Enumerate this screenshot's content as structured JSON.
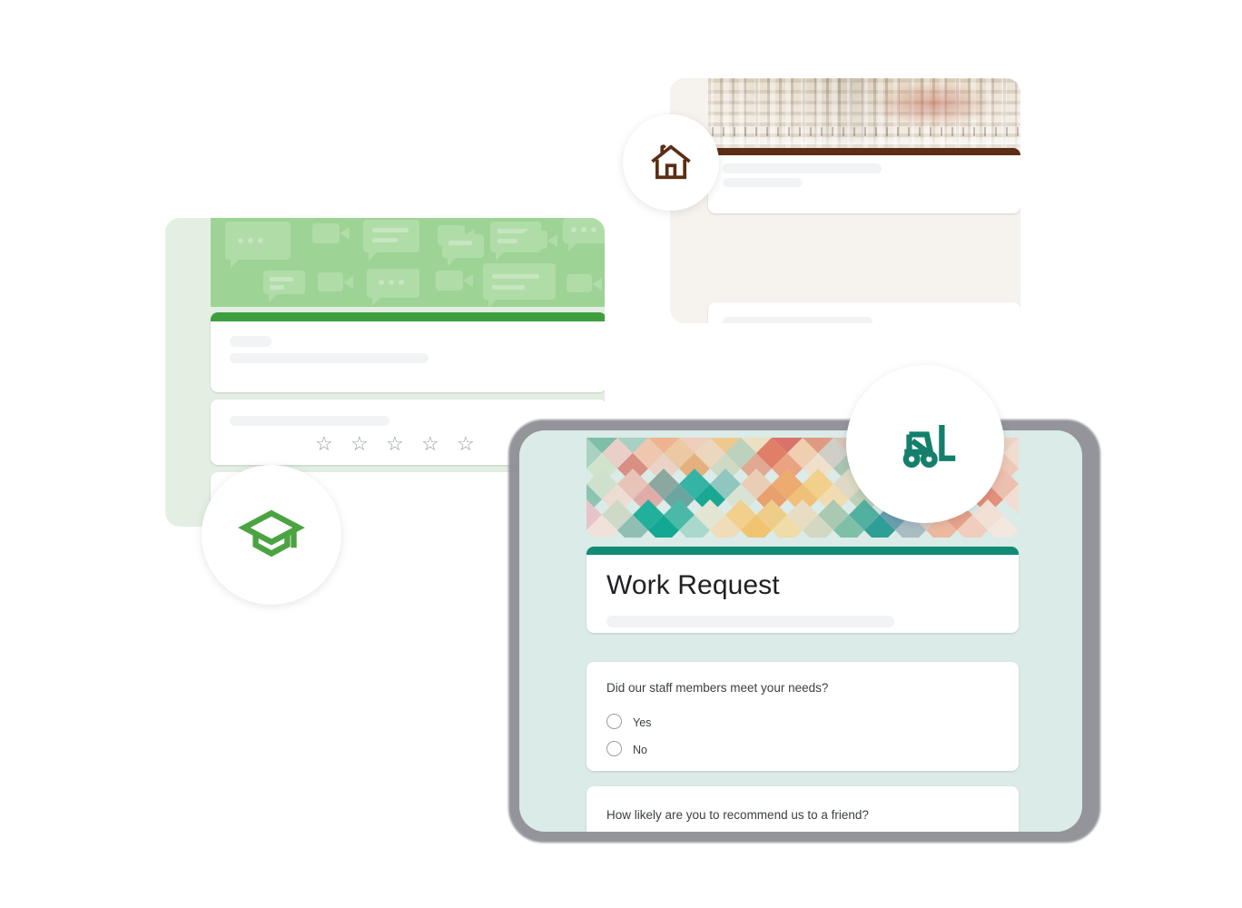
{
  "scene": {
    "title": "Google Forms template collage",
    "cards": [
      {
        "id": "education-form",
        "theme_label": "Education",
        "badge_icon": "graduation-cap-icon",
        "accent_color": "#3f9f3f",
        "surface_color": "#e3efe2",
        "banner_color": "#9ed396",
        "banner_pattern": "chat-bubbles-and-video-cameras",
        "rating_stars": 5,
        "placeholder_rows": 4
      },
      {
        "id": "home-services-form",
        "theme_label": "Home",
        "badge_icon": "house-icon",
        "accent_color": "#5b2e15",
        "surface_color": "#f6f2ed",
        "banner_pattern": "building-night-photo",
        "radio_options": 2,
        "placeholder_rows": 4
      },
      {
        "id": "work-request-form",
        "theme_label": "Work Request",
        "badge_icon": "forklift-icon",
        "accent_color": "#0f8c73",
        "surface_color": "#daebe8",
        "banner_pattern": "geometric-diamond-mosaic"
      }
    ]
  },
  "work_request_form": {
    "title": "Work Request",
    "description_placeholder": "",
    "questions": [
      {
        "text": "Did our staff members meet your needs?",
        "type": "radio",
        "options": [
          {
            "label": "Yes",
            "selected": false
          },
          {
            "label": "No",
            "selected": false
          }
        ]
      },
      {
        "text": "How likely are you to recommend us to a friend?",
        "type": "scale",
        "options": []
      }
    ]
  },
  "education_form": {
    "rating": {
      "type": "stars",
      "count": 5,
      "glyph": "☆",
      "selected": 0
    }
  },
  "colors": {
    "green_accent": "#3f9f3f",
    "green_banner": "#9ed396",
    "green_surface": "#e3efe2",
    "brown_accent": "#5b2e15",
    "beige_surface": "#f6f2ed",
    "teal_accent": "#0f8c73",
    "teal_surface": "#daebe8",
    "shadow_gray": "#8b8b93",
    "placeholder_gray": "#f1f3f4",
    "radio_outline": "#9aa0a6",
    "text_primary": "#202124",
    "text_secondary": "#3c4043"
  }
}
